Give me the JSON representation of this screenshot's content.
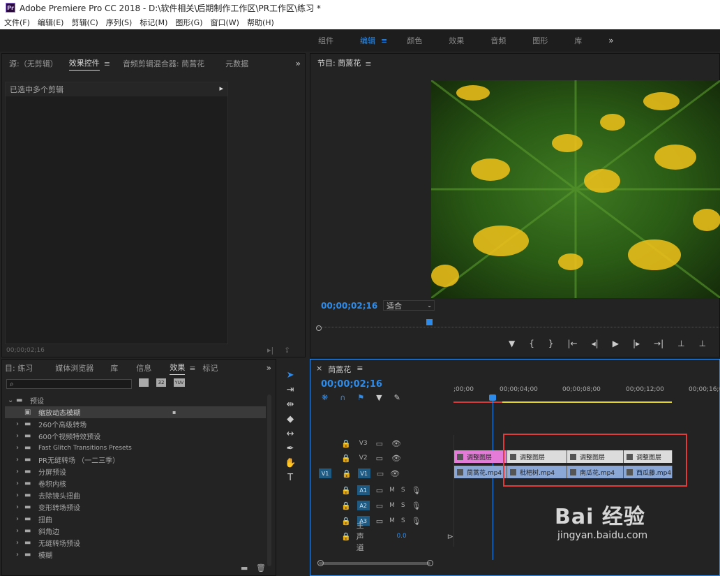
{
  "window": {
    "title": "Adobe Premiere Pro CC 2018 - D:\\软件相关\\后期制作工作区\\PR工作区\\练习 *",
    "logo_text": "Pr"
  },
  "menu": [
    "文件(F)",
    "编辑(E)",
    "剪辑(C)",
    "序列(S)",
    "标记(M)",
    "图形(G)",
    "窗口(W)",
    "帮助(H)"
  ],
  "workspaces": [
    "组件",
    "编辑",
    "颜色",
    "效果",
    "音频",
    "图形",
    "库"
  ],
  "source_panel": {
    "tabs": [
      "源:（无剪辑）",
      "效果控件",
      "音频剪辑混合器: 茼蒿花",
      "元数据"
    ],
    "message": "已选中多个剪辑",
    "timecode": "00;00;02;16"
  },
  "program_panel": {
    "title": "节目: 茼蒿花",
    "timecode": "00;00;02;16",
    "fit_label": "适合"
  },
  "project_panel": {
    "tabs": [
      "目: 练习",
      "媒体浏览器",
      "库",
      "信息",
      "效果",
      "标记"
    ],
    "tree": [
      {
        "label": "预设",
        "expanded": true,
        "level": 0
      },
      {
        "label": "缩放动态模糊",
        "level": 1,
        "selected": true
      },
      {
        "label": "260个高级转场",
        "level": 1
      },
      {
        "label": "600个视频特效预设",
        "level": 1
      },
      {
        "label": "Fast Glitch Transitions Presets",
        "level": 1
      },
      {
        "label": "PR无缝转场 （一二三季）",
        "level": 1
      },
      {
        "label": "分屏预设",
        "level": 1
      },
      {
        "label": "卷积内核",
        "level": 1
      },
      {
        "label": "去除镜头扭曲",
        "level": 1
      },
      {
        "label": "变形转场预设",
        "level": 1
      },
      {
        "label": "扭曲",
        "level": 1
      },
      {
        "label": "斜角边",
        "level": 1
      },
      {
        "label": "无缝转场预设",
        "level": 1
      },
      {
        "label": "模糊",
        "level": 1
      }
    ],
    "filter_badges": [
      "32",
      "YUV"
    ]
  },
  "timeline": {
    "title": "茼蒿花",
    "timecode": "00;00;02;16",
    "ruler": [
      ";00;00",
      "00;00;04;00",
      "00;00;08;00",
      "00;00;12;00",
      "00;00;16;00"
    ],
    "tracks": [
      {
        "name": "V3",
        "type": "video"
      },
      {
        "name": "V2",
        "type": "video"
      },
      {
        "name": "V1",
        "type": "video",
        "source": "V1"
      },
      {
        "name": "A1",
        "type": "audio",
        "source": "A1"
      },
      {
        "name": "A2",
        "type": "audio"
      },
      {
        "name": "A3",
        "type": "audio"
      }
    ],
    "master": {
      "label": "主声道",
      "value": "0.0"
    },
    "track_buttons": [
      "M",
      "S"
    ],
    "v2_clips": [
      "调整图层",
      "调整图层",
      "调整图层",
      "调整图层"
    ],
    "v1_clips": [
      "茼蒿花.mp4",
      "枇杷树.mp4",
      "南瓜花.mp4",
      "西瓜藤.mp4"
    ]
  },
  "watermark": {
    "brand": "Bai 经验",
    "url": "jingyan.baidu.com"
  },
  "colors": {
    "accent": "#2d8ceb",
    "adjustment_clip": "#e47bd8",
    "video_clip": "#8aa7d6",
    "highlight": "#e03c3c"
  }
}
